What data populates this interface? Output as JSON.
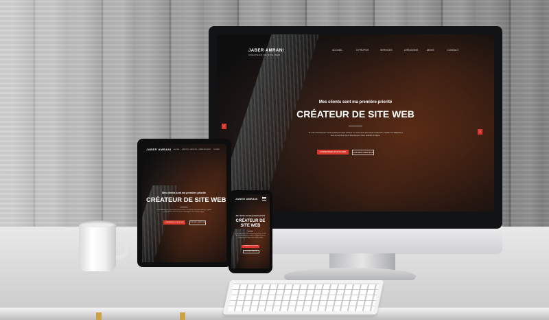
{
  "site": {
    "brand": "JABER AMRANI",
    "brand_sub": "CRÉATEUR DE SITE WEB",
    "nav": [
      "ACCUEIL",
      "À PROPOS",
      "SERVICES",
      "CRÉATIONS",
      "DEVIS",
      "CONTACT"
    ],
    "tagline": "Mes clients sont ma première priorité",
    "hero_title": "CRÉATEUR DE SITE WEB",
    "body_text": "Je suis développeur web freelance basé à Paris. Je crée des sites web modernes, rapides et adaptés à tous les écrans pour développer votre activité en ligne.",
    "primary_button": "COMMANDER UN SITE WEB",
    "secondary_button": "VOIR MES CRÉATIONS"
  },
  "colors": {
    "accent": "#d9392f",
    "screen_dark": "#1a1c1d",
    "wall": "#9c9c9c"
  }
}
